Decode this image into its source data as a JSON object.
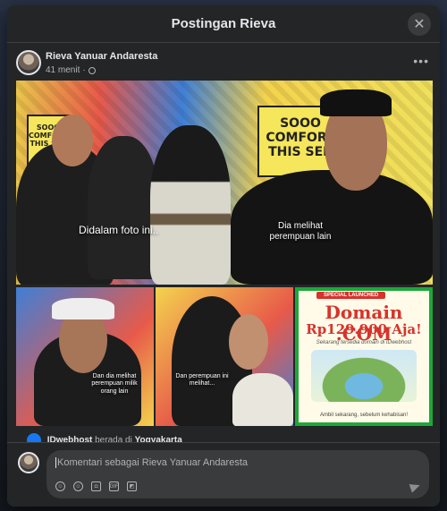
{
  "modal": {
    "title": "Postingan Rieva",
    "close_icon": "close-icon"
  },
  "post": {
    "author": "Rieva Yanuar Andaresta",
    "time": "41 menit",
    "separator": "·",
    "privacy_icon": "globe-icon",
    "more_label": "•••"
  },
  "photos": {
    "big_caption_left": "Didalam foto ini..",
    "big_caption_right_line1": "Dia melihat",
    "big_caption_right_line2": "perempuan lain",
    "sign_left_line1": "SOOO",
    "sign_left_line2": "COMFORT",
    "sign_left_line3": "THIS SER",
    "sign_right_line1": "SOOO",
    "sign_right_line2": "COMFORT",
    "sign_right_line3": "THIS SER",
    "tile1_caption": "Dan dia melihat perempuan milik orang lain",
    "tile2_caption_line1": "Dan perempuan ini",
    "tile2_caption_line2": "melihat...",
    "ad_badge": "SPECIAL LAUNCHED",
    "ad_domain": "Domain .COM",
    "ad_price": "Rp129.900 Aja!",
    "ad_sub": "Sekarang tersedia domain di IDwebhost",
    "ad_footer": "Ambil sekarang, sebelum kehabisan!"
  },
  "repost": {
    "page": "IDwebhost",
    "text": "berada di",
    "location": "Yogyakarta"
  },
  "composer": {
    "placeholder": "Komentari sebagai Rieva Yanuar Andaresta",
    "tools": [
      "avatar-sticker-icon",
      "emoji-icon",
      "camera-icon",
      "gif-icon",
      "sticker-icon"
    ],
    "gif_label": "GIF"
  }
}
